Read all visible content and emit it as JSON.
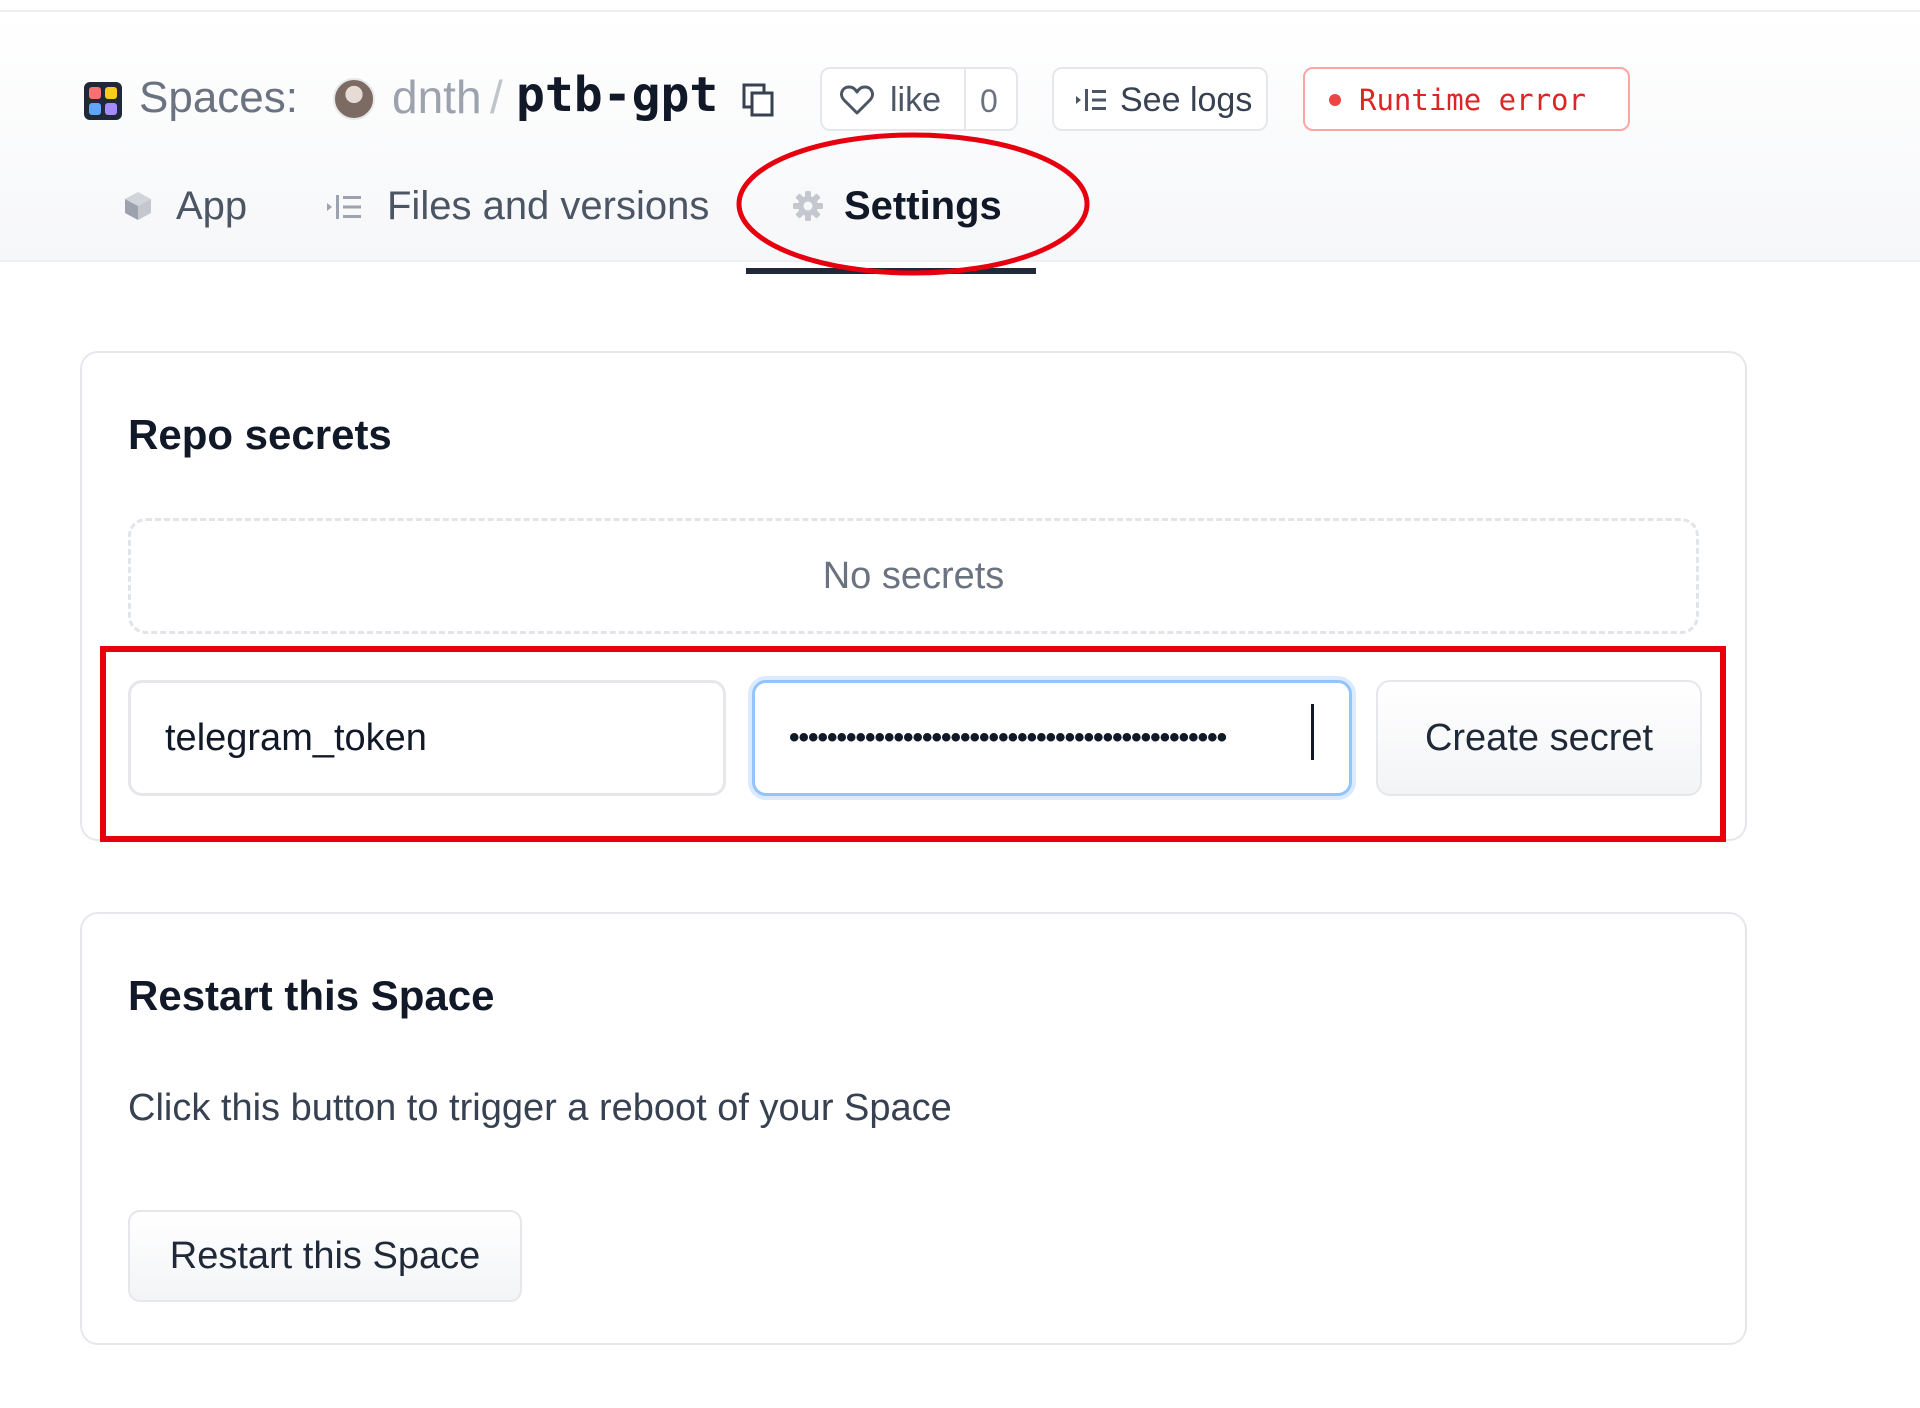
{
  "header": {
    "spaces_label": "Spaces:",
    "owner": "dnth",
    "separator": "/",
    "repo": "ptb-gpt",
    "like_label": "like",
    "like_count": "0",
    "logs_label": "See logs",
    "status_label": "Runtime error",
    "status_color": "#dc2626"
  },
  "tabs": [
    {
      "label": "App",
      "icon": "cube-icon"
    },
    {
      "label": "Files and versions",
      "icon": "files-icon"
    },
    {
      "label": "Settings",
      "icon": "gear-icon",
      "active": true
    }
  ],
  "secrets": {
    "title": "Repo secrets",
    "empty_text": "No secrets",
    "name_value": "telegram_token",
    "secret_value_masked": "••••••••••••••••••••••••••••••••••••••••••••••",
    "create_label": "Create secret"
  },
  "restart": {
    "title": "Restart this Space",
    "description": "Click this button to trigger a reboot of your Space",
    "button_label": "Restart this Space"
  },
  "annotation_color": "#e6000f"
}
